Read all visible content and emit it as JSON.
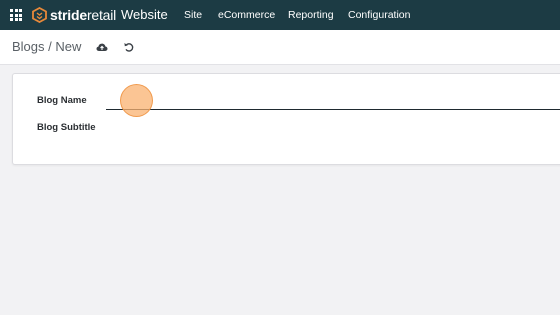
{
  "navbar": {
    "apps_icon": "grid-apps-icon",
    "logo": {
      "strong": "stride",
      "light": "retail",
      "icon": "stride-logo-icon",
      "accent": "#e8893a"
    },
    "app_title": "Website",
    "menu": [
      "Site",
      "eCommerce",
      "Reporting",
      "Configuration"
    ],
    "background": "#1c3b44"
  },
  "control": {
    "breadcrumb": "Blogs / New",
    "save_icon": "cloud-upload-icon",
    "discard_icon": "undo-icon"
  },
  "form": {
    "fields": [
      {
        "label": "Blog Name",
        "value": ""
      },
      {
        "label": "Blog Subtitle",
        "value": ""
      }
    ]
  },
  "overlay": {
    "click_marker_color": "#fab270"
  }
}
